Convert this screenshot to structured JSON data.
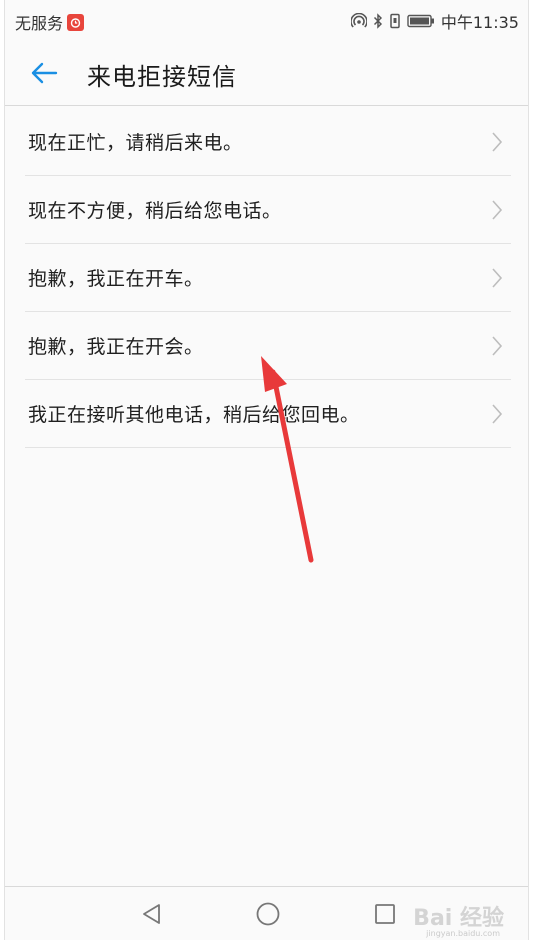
{
  "status_bar": {
    "carrier": "无服务",
    "time": "中午11:35"
  },
  "header": {
    "title": "来电拒接短信",
    "back_icon": "back-arrow-icon"
  },
  "list": {
    "items": [
      {
        "label": "现在正忙，请稍后来电。"
      },
      {
        "label": "现在不方便，稍后给您电话。"
      },
      {
        "label": "抱歉，我正在开车。"
      },
      {
        "label": "抱歉，我正在开会。"
      },
      {
        "label": "我正在接听其他电话，稍后给您回电。"
      }
    ]
  },
  "nav_bar": {
    "back": "nav-back-icon",
    "home": "nav-home-icon",
    "recents": "nav-recents-icon"
  },
  "watermark": {
    "text": "Bai 经验",
    "sub": "jingyan.baidu.com"
  },
  "colors": {
    "accent": "#1a8fe3",
    "arrow": "#e8393a",
    "divider": "#e3e3e3"
  }
}
